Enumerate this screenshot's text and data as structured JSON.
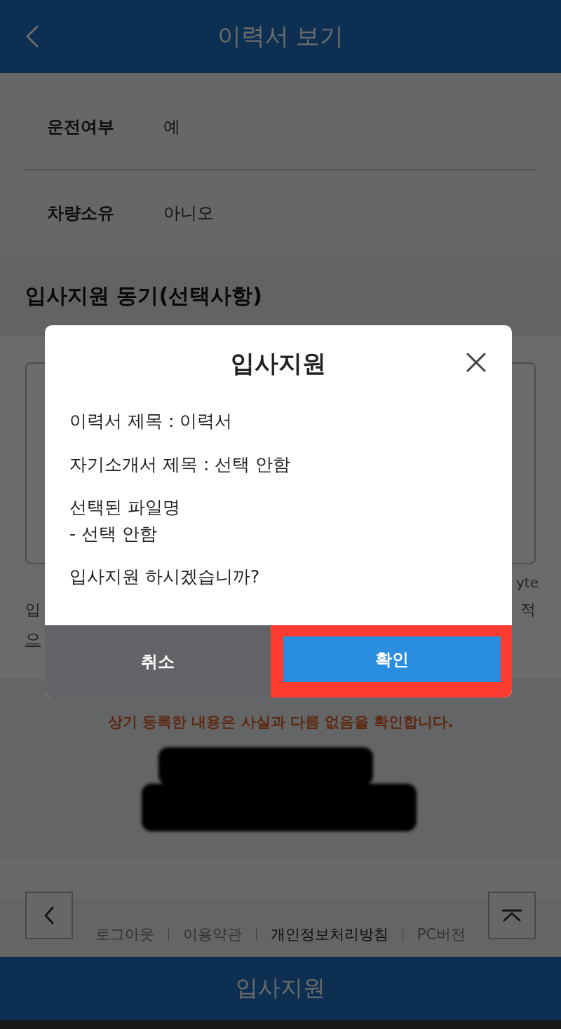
{
  "header": {
    "title": "이력서 보기"
  },
  "details": [
    {
      "label": "운전여부",
      "value": "예"
    },
    {
      "label": "차량소유",
      "value": "아니오"
    }
  ],
  "motivation": {
    "title": "입사지원 동기(선택사항)",
    "counter_fragment": "yte",
    "fragment_lines": [
      {
        "left": "입",
        "right": "적"
      },
      {
        "left": "으"
      }
    ]
  },
  "confirm_notice": "상기 등록한 내용은 사실과 다름 없음을 확인합니다.",
  "footer": {
    "links": [
      {
        "label": "로그아웃",
        "emphasized": false
      },
      {
        "label": "이용약관",
        "emphasized": false
      },
      {
        "label": "개인정보처리방침",
        "emphasized": true
      },
      {
        "label": "PC버전",
        "emphasized": false
      }
    ]
  },
  "bottom_bar": {
    "label": "입사지원"
  },
  "dialog": {
    "title": "입사지원",
    "lines": [
      "이력서 제목 : 이력서",
      "자기소개서 제목 : 선택 안함",
      "선택된 파일명\n- 선택 안함",
      "입사지원 하시겠습니까?"
    ],
    "buttons": [
      {
        "label": "취소",
        "kind": "cancel",
        "highlighted": false
      },
      {
        "label": "확인",
        "kind": "confirm",
        "highlighted": true
      }
    ]
  }
}
